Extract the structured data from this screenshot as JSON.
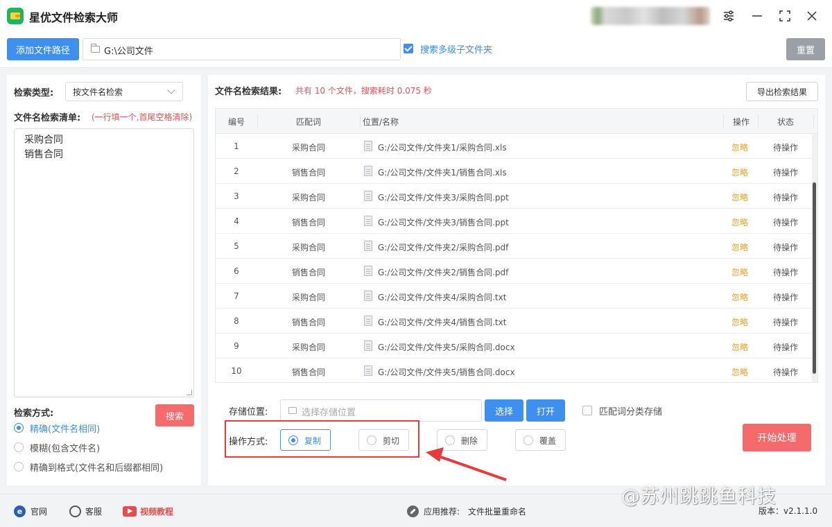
{
  "app": {
    "title": "星优文件检索大师"
  },
  "toolbar": {
    "add_path_label": "添加文件路径",
    "path_value": "G:\\公司文件",
    "subfolder_label": "搜索多级子文件夹",
    "subfolder_checked": true,
    "reset_label": "重置"
  },
  "left": {
    "search_type_label": "检索类型:",
    "search_type_value": "按文件名检索",
    "list_label": "文件名检索清单:",
    "list_hint": "(一行填一个,首尾空格清除)",
    "list_items": [
      "采购合同",
      "销售合同"
    ],
    "method_label": "检索方式:",
    "search_button": "搜索",
    "options": [
      {
        "label": "精确(文件名相同)",
        "selected": true
      },
      {
        "label": "模糊(包含文件名)",
        "selected": false
      },
      {
        "label": "精确到格式(文件名和后缀都相同)",
        "selected": false
      }
    ]
  },
  "results": {
    "title": "文件名检索结果:",
    "summary": "共有 10 个文件，搜索耗时 0.075 秒",
    "export_label": "导出检索结果",
    "columns": [
      "编号",
      "匹配词",
      "位置/名称",
      "操作",
      "状态"
    ],
    "rows": [
      {
        "num": "1",
        "keyword": "采购合同",
        "path": "G:/公司文件/文件夹1/采购合同.xls",
        "op": "忽略",
        "status": "待操作"
      },
      {
        "num": "2",
        "keyword": "销售合同",
        "path": "G:/公司文件/文件夹1/销售合同.xls",
        "op": "忽略",
        "status": "待操作"
      },
      {
        "num": "3",
        "keyword": "采购合同",
        "path": "G:/公司文件/文件夹3/采购合同.ppt",
        "op": "忽略",
        "status": "待操作"
      },
      {
        "num": "4",
        "keyword": "销售合同",
        "path": "G:/公司文件/文件夹3/销售合同.ppt",
        "op": "忽略",
        "status": "待操作"
      },
      {
        "num": "5",
        "keyword": "采购合同",
        "path": "G:/公司文件/文件夹2/采购合同.pdf",
        "op": "忽略",
        "status": "待操作"
      },
      {
        "num": "6",
        "keyword": "销售合同",
        "path": "G:/公司文件/文件夹2/销售合同.pdf",
        "op": "忽略",
        "status": "待操作"
      },
      {
        "num": "7",
        "keyword": "采购合同",
        "path": "G:/公司文件/文件夹4/采购合同.txt",
        "op": "忽略",
        "status": "待操作"
      },
      {
        "num": "8",
        "keyword": "销售合同",
        "path": "G:/公司文件/文件夹4/销售合同.txt",
        "op": "忽略",
        "status": "待操作"
      },
      {
        "num": "9",
        "keyword": "采购合同",
        "path": "G:/公司文件/文件夹5/采购合同.docx",
        "op": "忽略",
        "status": "待操作"
      },
      {
        "num": "10",
        "keyword": "销售合同",
        "path": "G:/公司文件/文件夹5/销售合同.docx",
        "op": "忽略",
        "status": "待操作"
      }
    ]
  },
  "storage": {
    "label": "存储位置:",
    "placeholder": "选择存储位置",
    "choose_label": "选择",
    "open_label": "打开",
    "classify_label": "匹配词分类存储",
    "classify_checked": false
  },
  "operation": {
    "label": "操作方式:",
    "options": [
      {
        "label": "复制",
        "selected": true
      },
      {
        "label": "剪切",
        "selected": false
      },
      {
        "label": "删除",
        "selected": false
      },
      {
        "label": "覆盖",
        "selected": false
      }
    ],
    "start_label": "开始处理"
  },
  "footer": {
    "website": "官网",
    "service": "客服",
    "video": "视频教程",
    "recommend_label": "应用推荐:",
    "recommend_app": "文件批量重命名",
    "version": "版本：v2.1.1.0",
    "watermark": "@苏州跳跳鱼科技"
  },
  "colors": {
    "accent": "#3d8ff0",
    "danger": "#f56b6b",
    "warning": "#f0a020",
    "highlight": "#e83a3a"
  },
  "icons": [
    "app-logo-icon",
    "settings-icon",
    "minimize-icon",
    "maximize-icon",
    "close-icon",
    "folder-icon",
    "chevron-down-icon",
    "file-icon",
    "website-icon",
    "service-icon",
    "video-icon",
    "link-icon"
  ]
}
